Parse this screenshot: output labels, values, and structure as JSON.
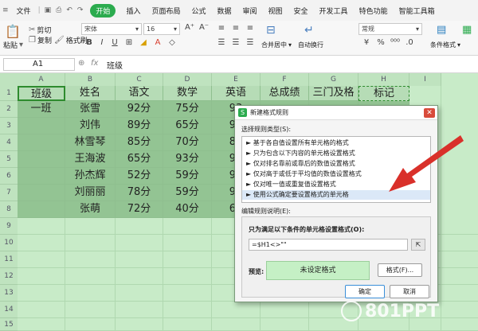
{
  "menubar": {
    "file": "文件",
    "start": "开始",
    "items": [
      "插入",
      "页面布局",
      "公式",
      "数据",
      "审阅",
      "视图",
      "安全",
      "开发工具",
      "特色功能",
      "智能工具箱"
    ]
  },
  "ribbon": {
    "paste": "粘贴",
    "cut": "剪切",
    "copy": "复制",
    "format_painter": "格式刷",
    "font_name": "宋体",
    "font_size": "16",
    "merge_center": "合并居中",
    "wrap": "自动换行",
    "number_format": "常规",
    "conditional_format": "条件格式",
    "table_style": "表格样式"
  },
  "formula_bar": {
    "name_box": "A1",
    "fx": "fx",
    "content": "班级"
  },
  "sheet": {
    "columns": [
      "A",
      "B",
      "C",
      "D",
      "E",
      "F",
      "G",
      "H",
      "I"
    ],
    "rows": [
      "1",
      "2",
      "3",
      "4",
      "5",
      "6",
      "7",
      "8",
      "9",
      "10",
      "11",
      "12",
      "13",
      "14",
      "15"
    ],
    "header": [
      "班级",
      "姓名",
      "语文",
      "数学",
      "英语",
      "总成绩",
      "三门及格",
      "标记"
    ],
    "data": [
      [
        "一班",
        "张雪",
        "92分",
        "75分",
        "93"
      ],
      [
        "",
        "刘伟",
        "89分",
        "65分",
        "91"
      ],
      [
        "",
        "林雪琴",
        "85分",
        "70分",
        "83"
      ],
      [
        "",
        "王海波",
        "65分",
        "93分",
        "93"
      ],
      [
        "",
        "孙杰辉",
        "52分",
        "59分",
        "93"
      ],
      [
        "",
        "刘丽丽",
        "78分",
        "59分",
        "93"
      ],
      [
        "",
        "张萌",
        "72分",
        "40分",
        "68"
      ]
    ]
  },
  "dialog": {
    "title": "新建格式规则",
    "select_type_label": "选择规则类型(S):",
    "rule_types": [
      "► 基于各自值设置所有单元格的格式",
      "► 只为包含以下内容的单元格设置格式",
      "► 仅对排名靠前或靠后的数值设置格式",
      "► 仅对高于或低于平均值的数值设置格式",
      "► 仅对唯一值或重复值设置格式",
      "► 使用公式确定要设置格式的单元格"
    ],
    "edit_desc_label": "编辑规则说明(E):",
    "formula_label": "只为满足以下条件的单元格设置格式(O):",
    "formula_value": "=$H1<>\"\"",
    "preview_label": "预览:",
    "preview_text": "未设定格式",
    "format_button": "格式(F)...",
    "ok": "确定",
    "cancel": "取消"
  },
  "watermark": "801PPT",
  "colors": {
    "accent": "#2bab4e",
    "sheet_bg": "#c8ebc8",
    "arrow": "#d9302a"
  }
}
